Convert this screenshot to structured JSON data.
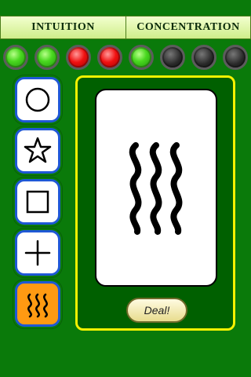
{
  "tabs": [
    {
      "label": "INTUITION"
    },
    {
      "label": "CONCENTRATION"
    }
  ],
  "lights": [
    {
      "state": "green"
    },
    {
      "state": "green"
    },
    {
      "state": "red"
    },
    {
      "state": "red"
    },
    {
      "state": "green"
    },
    {
      "state": "off"
    },
    {
      "state": "off"
    },
    {
      "state": "off"
    }
  ],
  "shape_buttons": [
    {
      "icon": "circle-icon",
      "selected": false
    },
    {
      "icon": "star-icon",
      "selected": false
    },
    {
      "icon": "square-icon",
      "selected": false
    },
    {
      "icon": "cross-icon",
      "selected": false
    },
    {
      "icon": "waves-icon",
      "selected": true
    }
  ],
  "card": {
    "icon": "waves-icon"
  },
  "deal_button": {
    "label": "Deal!"
  }
}
